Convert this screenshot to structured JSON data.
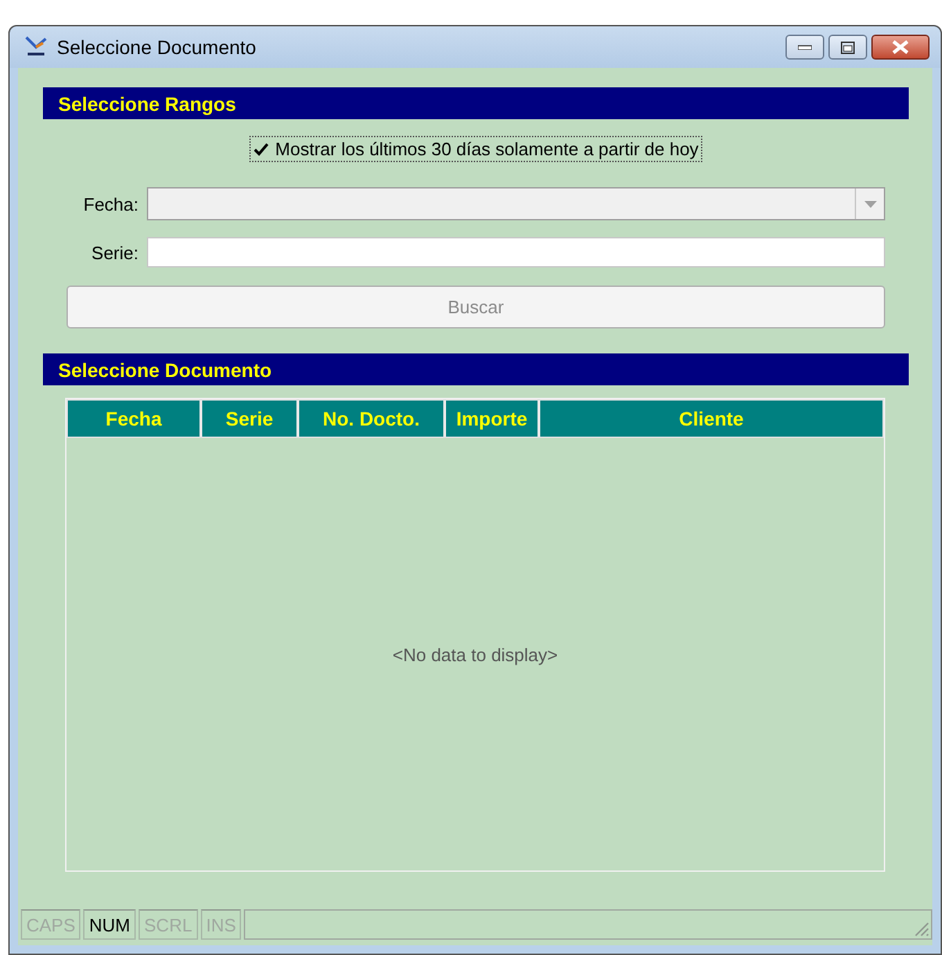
{
  "window": {
    "title": "Seleccione Documento"
  },
  "ranges": {
    "title": "Seleccione Rangos",
    "last_30_days": {
      "label": "Mostrar los últimos 30 días solamente a partir de hoy",
      "checked": true
    },
    "fecha": {
      "label": "Fecha:",
      "disabled": true
    },
    "serie": {
      "label": "Serie:"
    },
    "search_button": {
      "label": "Buscar",
      "disabled": true
    }
  },
  "documents": {
    "title": "Seleccione Documento",
    "columns": [
      {
        "label": "Fecha"
      },
      {
        "label": "Serie"
      },
      {
        "label": "No. Docto."
      },
      {
        "label": "Importe"
      },
      {
        "label": "Cliente"
      }
    ],
    "empty_text": "<No data to display>"
  },
  "status_bar": [
    {
      "label": "CAPS",
      "on": false
    },
    {
      "label": "NUM",
      "on": true
    },
    {
      "label": "SCRL",
      "on": false
    },
    {
      "label": "INS",
      "on": false
    }
  ]
}
